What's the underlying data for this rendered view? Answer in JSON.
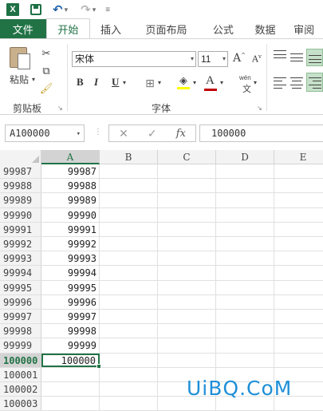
{
  "quick_access": {
    "app_icon": "excel-icon",
    "icons": [
      "save-icon",
      "undo-icon",
      "redo-icon",
      "customize-icon"
    ]
  },
  "tabs": [
    "文件",
    "开始",
    "插入",
    "页面布局",
    "公式",
    "数据",
    "审阅"
  ],
  "active_tab": "开始",
  "ribbon": {
    "clipboard": {
      "paste_label": "粘贴",
      "group_label": "剪贴板"
    },
    "font": {
      "font_name": "宋体",
      "font_size": "11",
      "group_label": "字体",
      "bold": "B",
      "italic": "I",
      "underline": "U",
      "grow": "A",
      "shrink": "A",
      "wen": "wén",
      "wen2": "文",
      "font_color": "A",
      "highlight_color": "#ffff00",
      "text_color": "#c00000"
    }
  },
  "formula_bar": {
    "name_box": "A100000",
    "fx": "fx",
    "cancel": "✕",
    "enter": "✓",
    "content": "100000"
  },
  "grid": {
    "columns": [
      "A",
      "B",
      "C",
      "D",
      "E"
    ],
    "selected_column": "A",
    "rows": [
      {
        "row": "99987",
        "a": "99987"
      },
      {
        "row": "99988",
        "a": "99988"
      },
      {
        "row": "99989",
        "a": "99989"
      },
      {
        "row": "99990",
        "a": "99990"
      },
      {
        "row": "99991",
        "a": "99991"
      },
      {
        "row": "99992",
        "a": "99992"
      },
      {
        "row": "99993",
        "a": "99993"
      },
      {
        "row": "99994",
        "a": "99994"
      },
      {
        "row": "99995",
        "a": "99995"
      },
      {
        "row": "99996",
        "a": "99996"
      },
      {
        "row": "99997",
        "a": "99997"
      },
      {
        "row": "99998",
        "a": "99998"
      },
      {
        "row": "99999",
        "a": "99999"
      },
      {
        "row": "100000",
        "a": "100000"
      },
      {
        "row": "100001",
        "a": ""
      },
      {
        "row": "100002",
        "a": ""
      },
      {
        "row": "100003",
        "a": ""
      }
    ],
    "active_row": "100000"
  },
  "watermark": "UiBQ.CoM",
  "colors": {
    "accent": "#217346"
  }
}
